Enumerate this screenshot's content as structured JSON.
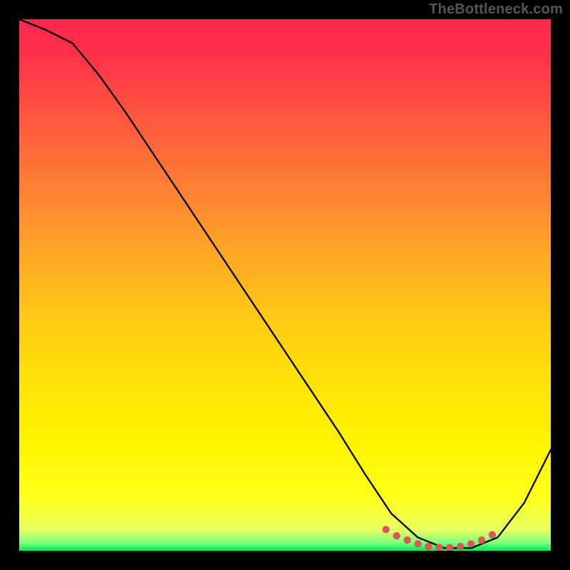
{
  "attribution": "TheBottleneck.com",
  "chart_data": {
    "type": "line",
    "title": "",
    "xlabel": "",
    "ylabel": "",
    "xlim": [
      0,
      100
    ],
    "ylim": [
      0,
      100
    ],
    "x": [
      0,
      5,
      10,
      15,
      20,
      25,
      30,
      35,
      40,
      45,
      50,
      55,
      60,
      65,
      70,
      75,
      80,
      85,
      90,
      95,
      100
    ],
    "values": [
      100,
      98,
      95.5,
      89.5,
      82.5,
      75,
      67.5,
      60,
      52.5,
      45,
      37.5,
      30,
      22.5,
      14.5,
      7,
      2.5,
      0.5,
      0.5,
      2.5,
      9,
      19
    ],
    "highlight": {
      "x": [
        69,
        71,
        73,
        75,
        77,
        79,
        81,
        83,
        85,
        87,
        89
      ],
      "values": [
        4.0,
        2.8,
        2.0,
        1.3,
        0.8,
        0.6,
        0.6,
        0.8,
        1.3,
        2.0,
        3.0
      ]
    },
    "gradient_stops": [
      {
        "offset": 0.0,
        "color": "#ff2850"
      },
      {
        "offset": 0.06,
        "color": "#ff2e4a"
      },
      {
        "offset": 0.18,
        "color": "#ff5640"
      },
      {
        "offset": 0.3,
        "color": "#ff7a36"
      },
      {
        "offset": 0.42,
        "color": "#ffa028"
      },
      {
        "offset": 0.55,
        "color": "#ffc618"
      },
      {
        "offset": 0.68,
        "color": "#ffe208"
      },
      {
        "offset": 0.8,
        "color": "#fff400"
      },
      {
        "offset": 0.9,
        "color": "#ffff1a"
      },
      {
        "offset": 0.96,
        "color": "#e8ff60"
      },
      {
        "offset": 0.985,
        "color": "#80ff80"
      },
      {
        "offset": 1.0,
        "color": "#00e853"
      }
    ]
  }
}
